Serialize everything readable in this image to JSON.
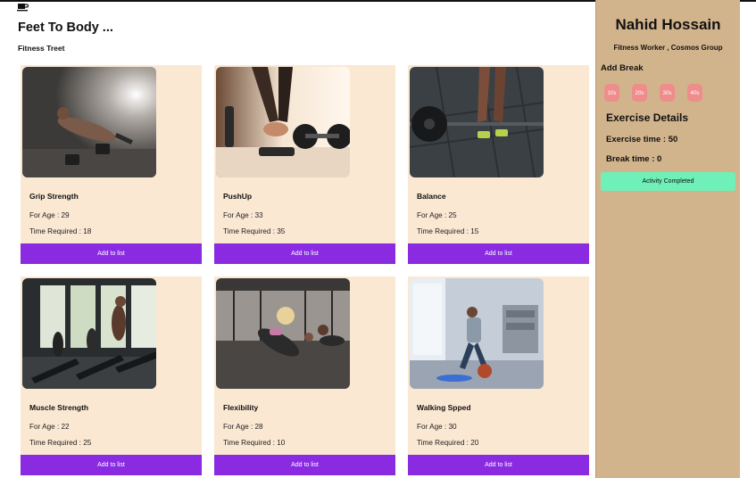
{
  "header": {
    "brand": "Feet To Body ...",
    "subtitle": "Fitness Treet",
    "logo_icon": "coffee-cup-icon"
  },
  "cards": [
    {
      "name": "Grip Strength",
      "age": "For Age : 29",
      "time": "Time Required : 18",
      "button": "Add to list",
      "photo": "man-pushup-dumbbells"
    },
    {
      "name": "PushUp",
      "age": "For Age : 33",
      "time": "Time Required : 35",
      "button": "Add to list",
      "photo": "dumbbell-on-floor"
    },
    {
      "name": "Balance",
      "age": "For Age : 25",
      "time": "Time Required : 15",
      "button": "Add to list",
      "photo": "barbell-lift"
    },
    {
      "name": "Muscle Strength",
      "age": "For Age : 22",
      "time": "Time Required : 25",
      "button": "Add to list",
      "photo": "treadmill-gym"
    },
    {
      "name": "Flexibility",
      "age": "For Age : 28",
      "time": "Time Required : 10",
      "button": "Add to list",
      "photo": "group-pushups"
    },
    {
      "name": "Walking Spped",
      "age": "For Age : 30",
      "time": "Time Required : 20",
      "button": "Add to list",
      "photo": "home-workout"
    }
  ],
  "sidebar": {
    "name": "Nahid Hossain",
    "role": "Fitness Worker , Cosmos Group",
    "add_break_title": "Add Break",
    "breaks": [
      "10s",
      "20s",
      "30s",
      "40s"
    ],
    "details_title": "Exercise Details",
    "exercise_time": "Exercise time : 50",
    "break_time": "Break time : 0",
    "complete_button": "Activity Completed"
  },
  "colors": {
    "card_bg": "#fbe8d3",
    "button": "#8a2be2",
    "sidebar_bg": "#d2b48c",
    "break_button": "#ef8c8c",
    "complete_button": "#6ef0b8"
  }
}
